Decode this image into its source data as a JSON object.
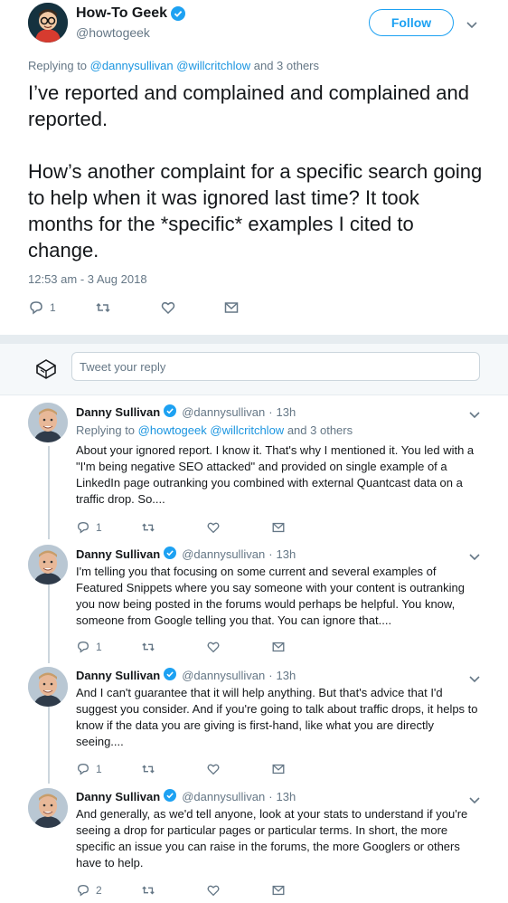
{
  "main_tweet": {
    "author_name": "How-To Geek",
    "author_handle": "@howtogeek",
    "follow_label": "Follow",
    "replying_prefix": "Replying to",
    "replying_to": [
      "@dannysullivan",
      "@willcritchlow"
    ],
    "replying_suffix": "and 3 others",
    "text": "I’ve reported and complained and complained and reported.\n\nHow’s another complaint for a specific search going to help when it was ignored last time? It took months for the *specific* examples I cited to change.",
    "timestamp": "12:53 am - 3 Aug 2018",
    "reply_count": "1",
    "icons": [
      "reply-icon",
      "retweet-icon",
      "like-icon",
      "message-icon"
    ]
  },
  "reply_box": {
    "placeholder": "Tweet your reply"
  },
  "replies": [
    {
      "name": "Danny Sullivan",
      "handle": "@dannysullivan",
      "time": "13h",
      "replying_prefix": "Replying to",
      "replying_to": [
        "@howtogeek",
        "@willcritchlow"
      ],
      "replying_suffix": "and 3 others",
      "text": "About your ignored report. I know it. That's why I mentioned it. You led with a \"I'm being negative SEO attacked\" and provided on single example of a LinkedIn page outranking you combined with external Quantcast data on a traffic drop. So....",
      "reply_count": "1"
    },
    {
      "name": "Danny Sullivan",
      "handle": "@dannysullivan",
      "time": "13h",
      "text": "I'm telling you that focusing on some current and several examples of Featured Snippets where you say someone with your content is outranking you now being posted in the forums would perhaps be helpful. You know, someone from Google telling you that. You can ignore that....",
      "reply_count": "1"
    },
    {
      "name": "Danny Sullivan",
      "handle": "@dannysullivan",
      "time": "13h",
      "text": "And I can't guarantee that it will help anything. But that's advice that I'd suggest you consider. And if you're going to talk about traffic drops, it helps to know if the data you are giving is first-hand, like what you are directly seeing....",
      "reply_count": "1"
    },
    {
      "name": "Danny Sullivan",
      "handle": "@dannysullivan",
      "time": "13h",
      "text": "And generally, as we'd tell anyone, look at your stats to understand if you're seeing a drop for particular pages or particular terms. In short, the more specific an issue you can raise in the forums, the more Googlers or others have to help.",
      "reply_count": "2"
    }
  ],
  "colors": {
    "accent": "#1da1f2",
    "link": "#1b95e0",
    "muted": "#657786",
    "separator": "#e6ecf0"
  }
}
